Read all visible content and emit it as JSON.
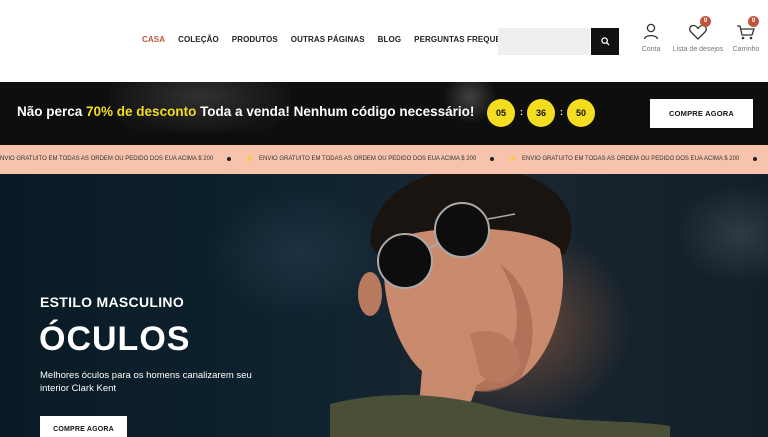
{
  "header": {
    "nav": [
      {
        "label": "CASA",
        "active": true
      },
      {
        "label": "COLEÇÃO",
        "active": false
      },
      {
        "label": "PRODUTOS",
        "active": false
      },
      {
        "label": "OUTRAS PÁGINAS",
        "active": false
      },
      {
        "label": "BLOG",
        "active": false
      },
      {
        "label": "PERGUNTAS FREQUENTES",
        "active": false
      }
    ],
    "search": {
      "placeholder": "",
      "icon": "search-icon"
    },
    "account": {
      "label": "Conta",
      "icon": "user-icon"
    },
    "wishlist": {
      "label": "Lista de desejos",
      "icon": "heart-icon",
      "count": "0"
    },
    "cart": {
      "label": "Carrinho",
      "icon": "cart-icon",
      "count": "0"
    }
  },
  "promo": {
    "text_before": "Não perca ",
    "highlight": "70% de desconto",
    "text_after": " Toda a venda! Nenhum código necessário!",
    "countdown": [
      "05",
      "36",
      "50"
    ],
    "separator": ":",
    "button": "COMPRE AGORA"
  },
  "marquee": {
    "message": "ENVIO GRATUITO EM TODAS AS ORDEM OU PEDIDO DOS EUA ACIMA $ 200",
    "icon": "bolt-icon"
  },
  "hero": {
    "subtitle": "ESTILO MASCULINO",
    "title": "ÓCULOS",
    "description": "Melhores óculos para os homens canalizarem seu interior Clark Kent",
    "button": "COMPRE AGORA"
  },
  "colors": {
    "accent": "#c0553f",
    "highlight": "#f3dd1e",
    "marquee_bg": "#f7c3ad",
    "promo_bg": "#0e0e0e",
    "hero_bg": "#0e2330"
  }
}
